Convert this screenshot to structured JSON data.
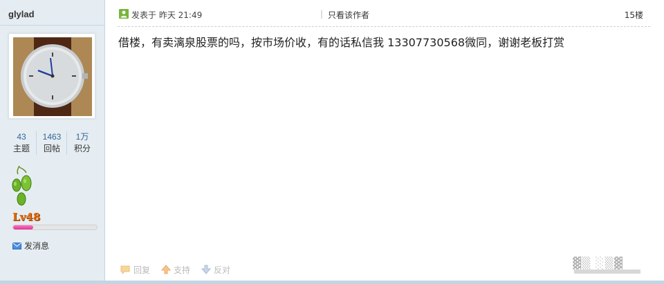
{
  "user": {
    "name": "glylad",
    "stats": [
      {
        "value": "43",
        "label": "主题"
      },
      {
        "value": "1463",
        "label": "回帖"
      },
      {
        "value": "1万",
        "label": "积分"
      }
    ],
    "level": "Lv48",
    "level_progress": 0.24,
    "message_label": "发消息"
  },
  "post": {
    "meta": "发表于 昨天 21:49",
    "only_author": "只看该作者",
    "floor": "15楼",
    "content": "借楼，有卖漓泉股票的吗，按市场价收，有的话私信我 13307730568微同，谢谢老板打赏"
  },
  "actions": {
    "reply": "回复",
    "support": "支持",
    "oppose": "反对"
  },
  "colors": {
    "sidebar_bg": "#e5edf2",
    "link": "#336699",
    "online_icon": "#79b43c",
    "level_bar": "#e02f98"
  }
}
